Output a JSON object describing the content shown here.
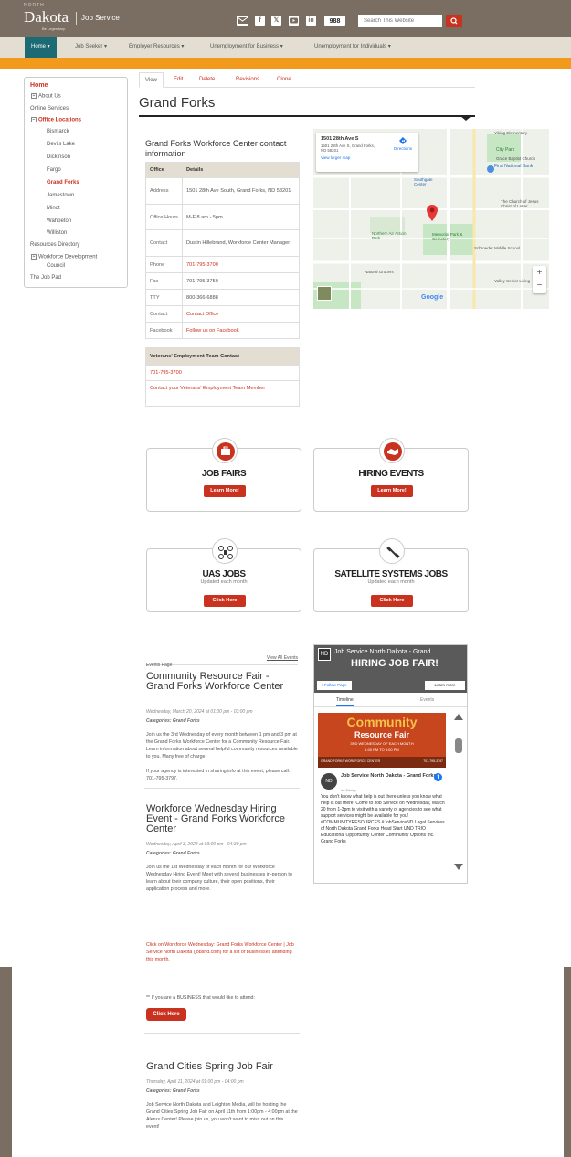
{
  "header": {
    "state_small": "NORTH",
    "logo": "Dakota",
    "logo_sub": "Be Legendary.",
    "service": "Job Service",
    "search_placeholder": "Search This Website"
  },
  "social": {
    "linkedin": "in",
    "ndcode": "988"
  },
  "nav": [
    "Home",
    "Job Seeker",
    "Employer Resources",
    "Unemployment for Business",
    "Unemployment for Individuals"
  ],
  "sidebar": {
    "home": "Home",
    "items": [
      "About Us",
      "Online Services",
      "Office Locations",
      "Bismarck",
      "Devils Lake",
      "Dickinson",
      "Fargo",
      "Grand Forks",
      "Jamestown",
      "Minot",
      "Wahpeton",
      "Williston",
      "Resources Directory",
      "Workforce Development",
      "Council",
      "The Job Pad"
    ]
  },
  "tabs": [
    "View",
    "Edit",
    "Delete",
    "Revisions",
    "Clone"
  ],
  "page_title": "Grand Forks",
  "contact": {
    "title": "Grand Forks Workforce Center contact information",
    "headers": [
      "Office",
      "Details"
    ],
    "rows": [
      {
        "k": "Address",
        "v": "1501 28th Ave South, Grand Forks, ND 58201"
      },
      {
        "k": "Office Hours",
        "v": "M-F 8 am - 5pm"
      },
      {
        "k": "Contact",
        "v": "Dustin Hillebrand, Workforce Center Manager"
      },
      {
        "k": "Phone",
        "v": "701-795-3700"
      },
      {
        "k": "Fax",
        "v": "701-795-3750"
      },
      {
        "k": "TTY",
        "v": "800-366-6888"
      },
      {
        "k": "Contact",
        "v": "Contact Office"
      },
      {
        "k": "Facebook",
        "v": "Follow us on Facebook"
      }
    ],
    "vet_title": "Veterans' Employment Team Contact",
    "vet_phone": "701-795-3700",
    "vet_link": "Contact your Veterans' Employment Team Member"
  },
  "map": {
    "addr_title": "1501 28th Ave S",
    "addr_full": "1501 28th Ave S, Grand Forks, ND 58201",
    "directions": "Directions",
    "larger": "View larger map",
    "labels": [
      "Viking Elementary",
      "City Park",
      "Grace Baptist Church",
      "First National Bank",
      "Southgate Center",
      "The Church of Jesus Christ of Latter...",
      "Northern Air Action Park",
      "Memorial Park & Cemetery",
      "Schroeder Middle School",
      "Natural Grocers",
      "Valley Senior Living",
      "Google"
    ],
    "zoom_in": "+",
    "zoom_out": "−"
  },
  "cards": [
    {
      "title": "JOB FAIRS",
      "sub": "",
      "btn": "Learn More!"
    },
    {
      "title": "HIRING EVENTS",
      "sub": "",
      "btn": "Learn More!"
    },
    {
      "title": "UAS JOBS",
      "sub": "Updated each month",
      "btn": "Click Here"
    },
    {
      "title": "SATELLITE SYSTEMS JOBS",
      "sub": "Updated each month",
      "btn": "Click Here"
    }
  ],
  "events": {
    "page_label": "Events Page",
    "view_all": "View All Events",
    "list": [
      {
        "title": "Community Resource Fair - Grand Forks Workforce Center",
        "date": "Wednesday, March 20, 2024 at 01:00 pm - 03:00 pm",
        "cat": "Categories: Grand Forks",
        "p1": "Join us the 3rd Wednesday of every month between 1 pm and 3 pm at the Grand Forks Workforce Center for a Community Resource Fair. Learn information about several helpful community resources available to you. Many free of charge.",
        "p2": "If your agency is interested in sharing info at this event, please call: 701-795-3797."
      },
      {
        "title": "Workforce Wednesday Hiring Event - Grand Forks Workforce Center",
        "date": "Wednesday, April 3, 2024 at 03:00 pm - 04:30 pm",
        "cat": "Categories: Grand Forks",
        "p1": "Join us the 1st Wednesday of each month for our Workforce Wednesday Hiring Event! Meet with several businesses in-person to learn about their company culture, their open positions, their application process and more.",
        "p2": "Click on Workforce Wednesday: Grand Forks Workforce Center | Job Service North Dakota (jobsnd.com) for a list of businesses attending this month.",
        "p3": "** If you are a BUSINESS that would like to attend:",
        "btn": "Click Here"
      },
      {
        "title": "Grand Cities Spring Job Fair",
        "date": "Thursday, April 11, 2024 at 01:00 pm - 04:00 pm",
        "cat": "Categories: Grand Forks",
        "p1": "Job Service North Dakota and Leighton Media, will be hosting the Grand Cities Spring Job Fair on April 11th from 1:00pm - 4:00pm at the Alerus Center! Please join us, you won't want to miss out on this event!"
      }
    ]
  },
  "fb": {
    "page": "Job Service North Dakota - Grand...",
    "banner": "HIRING JOB FAIR!",
    "follow": "Follow Page",
    "learn": "Learn more",
    "tab1": "Timeline",
    "tab2": "Events",
    "poster1": "Community",
    "poster2": "Resource Fair",
    "poster3": "3RD WEDNESDAY OF EACH MONTH",
    "poster4": "1:00 PM TO 3:00 PM",
    "poster5": "GRAND FORKS WORKFORCE CENTER",
    "poster6": "701-795-3797",
    "post_author": "Job Service North Dakota - Grand Forks",
    "post_time": "on Friday",
    "post_text": "You don't know what help is out there unless you know what help is out there. Come to Job Service on Wednesday, March 20 from 1-3pm to visit with a variety of agencies to see what support services might be available for you! #COMMUNITYRESOURCES #JobServiceND Legal Services of North Dakota Grand Forks Head Start UND TRIO Educational Opportunity Center Community Options Inc. Grand Forks"
  }
}
